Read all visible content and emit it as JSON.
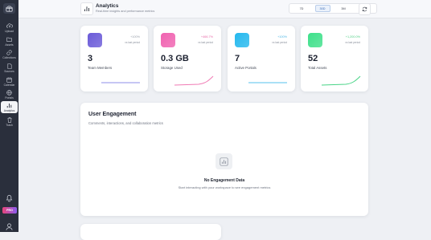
{
  "sidebar": {
    "logo": "box-logo-icon",
    "items": [
      {
        "label": "Upload",
        "icon": "cloud-upload-icon"
      },
      {
        "label": "Assets",
        "icon": "folder-icon"
      },
      {
        "label": "Collections",
        "icon": "link-icon"
      },
      {
        "label": "Sources",
        "icon": "file-icon"
      },
      {
        "label": "Calendar",
        "icon": "calendar-icon"
      },
      {
        "label": "Portals",
        "icon": "globe-icon"
      },
      {
        "label": "Analytics",
        "icon": "bar-chart-icon",
        "active": true
      },
      {
        "label": "Trash",
        "icon": "trash-icon"
      }
    ],
    "pro_label": "PRO",
    "bell_icon": "bell-icon",
    "user_icon": "user-icon"
  },
  "header": {
    "icon": "bar-chart-icon",
    "title": "Analytics",
    "subtitle": "Real-time insights and performance metrics",
    "ranges": [
      "7D",
      "30D",
      "3M",
      "1Y"
    ],
    "selected_range": "30D",
    "refresh_icon": "refresh-icon"
  },
  "stats": [
    {
      "value": "3",
      "label": "Team Members",
      "change": "+100%",
      "vs": "vs last period",
      "tile_color": "#6a5ad8",
      "change_color": "#9aa0ab",
      "trend": "flat",
      "line_color": "#8c8ee8"
    },
    {
      "value": "0.3 GB",
      "label": "Storage Used",
      "change": "+466.7%",
      "vs": "vs last period",
      "tile_color": "#f062b0",
      "change_color": "#e86aa8",
      "trend": "up",
      "line_color": "#f07ab4"
    },
    {
      "value": "7",
      "label": "Active Portals",
      "change": "+100%",
      "vs": "vs last period",
      "tile_color": "#24b8ee",
      "change_color": "#4fb8e6",
      "trend": "flat",
      "line_color": "#56c2ec"
    },
    {
      "value": "52",
      "label": "Total Assets",
      "change": "+1,200.0%",
      "vs": "vs last period",
      "tile_color": "#3ee08a",
      "change_color": "#4fcf85",
      "trend": "up",
      "line_color": "#48d486"
    }
  ],
  "engagement": {
    "title": "User Engagement",
    "subtitle": "Comments, interactions, and collaboration metrics",
    "empty_icon": "bar-chart-icon",
    "empty_title": "No Engagement Data",
    "empty_subtitle": "Start interacting with your workspace to see engagement metrics"
  }
}
